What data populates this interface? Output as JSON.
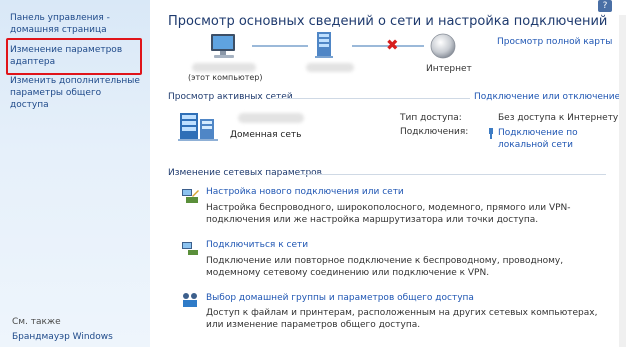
{
  "left_pane": {
    "home_link": "Панель управления - домашняя страница",
    "adapter_link": "Изменение параметров адаптера",
    "sharing_link": "Изменить дополнительные параметры общего доступа",
    "see_also_label": "См. также",
    "firewall_link": "Брандмауэр Windows"
  },
  "header": {
    "title": "Просмотр основных сведений о сети и настройка подключений",
    "help_icon_text": "?"
  },
  "map": {
    "full_map_link": "Просмотр полной карты",
    "this_computer_label": "(этот компьютер)",
    "internet_label": "Интернет"
  },
  "active_networks": {
    "heading": "Просмотр активных сетей",
    "connect_disconnect_link": "Подключение или отключение",
    "network_type": "Доменная сеть",
    "access_type_label": "Тип доступа:",
    "access_type_value": "Без доступа к Интернету",
    "connections_label": "Подключения:",
    "connections_value": "Подключение по локальной сети"
  },
  "change_settings": {
    "heading": "Изменение сетевых параметров",
    "tasks": [
      {
        "title": "Настройка нового подключения или сети",
        "desc": "Настройка беспроводного, широкополосного, модемного, прямого или VPN-подключения или же настройка маршрутизатора или точки доступа."
      },
      {
        "title": "Подключиться к сети",
        "desc": "Подключение или повторное подключение к беспроводному, проводному, модемному сетевому соединению или подключение к VPN."
      },
      {
        "title": "Выбор домашней группы и параметров общего доступа",
        "desc": "Доступ к файлам и принтерам, расположенным на других сетевых компьютерах, или изменение параметров общего доступа."
      }
    ]
  },
  "colors": {
    "link": "#1f56b3",
    "heading": "#1e3a6e",
    "highlight_border": "#e0141a",
    "left_pane_bg": "#d9e8f7",
    "error_x": "#d71e1e"
  }
}
